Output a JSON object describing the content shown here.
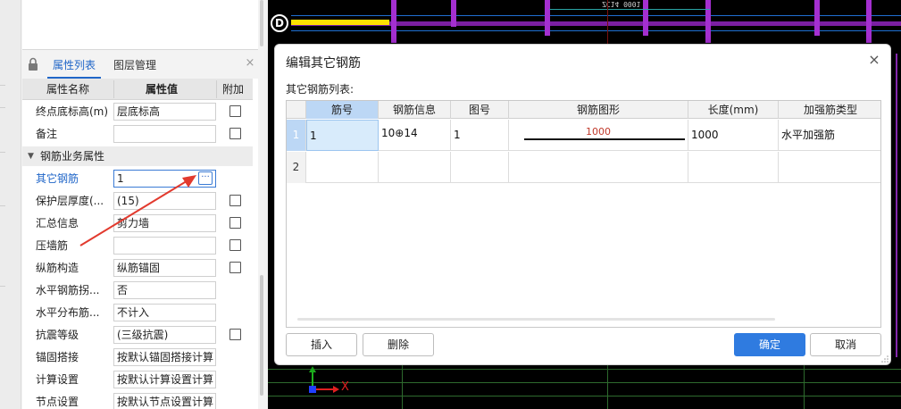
{
  "panel": {
    "tabs": [
      "属性列表",
      "图层管理"
    ],
    "close_label": "×",
    "header": {
      "name": "属性名称",
      "value": "属性值",
      "extra": "附加"
    },
    "rows_top": [
      {
        "name": "终点底标高(m)",
        "value": "层底标高"
      },
      {
        "name": "备注",
        "value": ""
      }
    ],
    "group_label": "钢筋业务属性",
    "rows": [
      {
        "name": "其它钢筋",
        "value": "1",
        "ellipsis": "···"
      },
      {
        "name": "保护层厚度(...",
        "value": "(15)"
      },
      {
        "name": "汇总信息",
        "value": "剪力墙"
      },
      {
        "name": "压墙筋",
        "value": ""
      },
      {
        "name": "纵筋构造",
        "value": "纵筋锚固"
      },
      {
        "name": "水平钢筋拐...",
        "value": "否"
      },
      {
        "name": "水平分布筋...",
        "value": "不计入"
      },
      {
        "name": "抗震等级",
        "value": "(三级抗震)"
      },
      {
        "name": "锚固搭接",
        "value": "按默认锚固搭接计算"
      },
      {
        "name": "计算设置",
        "value": "按默认计算设置计算"
      },
      {
        "name": "节点设置",
        "value": "按默认节点设置计算"
      }
    ]
  },
  "canvas": {
    "axis_label_d": "D",
    "axis_x_label": "X",
    "top_text": "ZC14 0001 HJ.C"
  },
  "dialog": {
    "title": "编辑其它钢筋",
    "close_label": "×",
    "list_label": "其它钢筋列表:",
    "columns": [
      "筋号",
      "钢筋信息",
      "图号",
      "钢筋图形",
      "长度(mm)",
      "加强筋类型"
    ],
    "rows": [
      {
        "no": "1",
        "bar_no": "1",
        "info": "10⊕14",
        "fig": "1",
        "shape_value": "1000",
        "length": "1000",
        "type": "水平加强筋"
      },
      {
        "no": "2",
        "bar_no": "",
        "info": "",
        "fig": "",
        "shape_value": "",
        "length": "",
        "type": ""
      }
    ],
    "buttons": {
      "insert": "插入",
      "delete": "删除",
      "ok": "确定",
      "cancel": "取消"
    }
  }
}
